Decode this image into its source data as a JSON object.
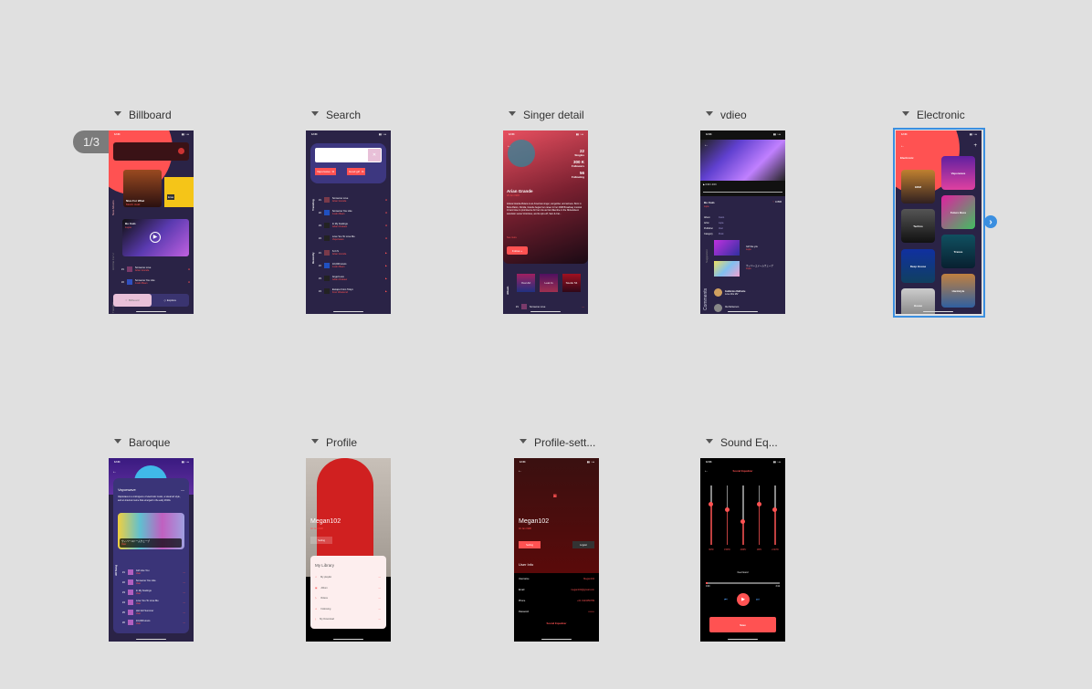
{
  "pager": "1/3",
  "frames": {
    "billboard": {
      "title": "Billboard",
      "side_new": "New Albums",
      "side_hit": "Hit One For U",
      "side_trend": "Trending",
      "album1": "Nice For What",
      "album1_artist": "Moshi Judd",
      "album2": "Eras",
      "video_title": "Bo Cuin",
      "video_sub": "Lupa",
      "songs": [
        {
          "n": "#1",
          "t": "Someone Love",
          "a": "Arian Grande"
        },
        {
          "n": "#2",
          "t": "Someone You Like",
          "a": "Justin Bean"
        }
      ],
      "tab_billboard": "Billboard",
      "tab_explore": "Explore"
    },
    "search": {
      "title": "Search",
      "chip1": "Vaporwave",
      "chip2": "Good girl",
      "trending": "Trending",
      "recently": "Recently",
      "trending_songs": [
        {
          "n": "#1",
          "t": "Someone Love",
          "a": "Arian Grande"
        },
        {
          "n": "#2",
          "t": "Someone You Like",
          "a": "Justin Bean"
        },
        {
          "n": "#3",
          "t": "In My Feelings",
          "a": "Adam Drakew"
        },
        {
          "n": "#4",
          "t": "Love You To Love Me",
          "a": "Vaporwave"
        }
      ],
      "recent_songs": [
        {
          "n": "#1",
          "t": "S.O.S",
          "a": "Arian Grande"
        },
        {
          "n": "#2",
          "t": "10,000 Hours",
          "a": "Justin Bean"
        },
        {
          "n": "#3",
          "t": "Angel Love",
          "a": "Adam Drakew"
        },
        {
          "n": "#4",
          "t": "Escape From Tokyo",
          "a": "Four Weekend"
        }
      ]
    },
    "singer": {
      "title": "Singer detail",
      "name": "Arian Grande",
      "dob": "26 Jun 1993",
      "singles": "22",
      "singles_l": "Singles",
      "followers": "300 K",
      "followers_l": "Followers",
      "following": "56",
      "following_l": "Following",
      "bio": "Ariana Grande-Butera is an American singer, songwriter, and actress. Born in Boca Raton, Florida, Grande began her career in her 2008 Broadway musical 13 and rose to prominence for her role as Cat Valentine in the Nickelodeon television series Victorious, and its spin-off, Sam & Cat...",
      "see_more": "See more",
      "follow": "Follow +",
      "albums_label": "Album",
      "albums": [
        "Your Art",
        "Lost In",
        "Studio 54"
      ],
      "song": "Someone Love",
      "song_n": "#1"
    },
    "video": {
      "title": "vdieo",
      "time": "0:00 / 4:03",
      "song": "Bo Cuin",
      "artist": "Lupa",
      "likes": "10586",
      "info": [
        [
          "Album",
          "Cuion"
        ],
        [
          "Artist",
          "Lupa"
        ],
        [
          "Publisher",
          "Vest"
        ],
        [
          "Category",
          "Punk"
        ]
      ],
      "suggest_label": "Suggestion",
      "suggest": [
        {
          "t": "Girl like you",
          "a": "Lupa"
        },
        {
          "t": "ウィバーユドームウェーブ",
          "a": "Lupa"
        }
      ],
      "comments_label": "Comments",
      "comments": [
        {
          "u": "Guillermo Dalfonte",
          "c": "Love this MV"
        },
        {
          "u": "Iba Nickerson",
          "c": ""
        }
      ]
    },
    "electronic": {
      "title": "Electronic",
      "heading": "Electronic",
      "genres": [
        "EDM",
        "Vaporwave",
        "Techno",
        "Future Bass",
        "Deep House",
        "Trance",
        "House",
        "Hardstyle"
      ]
    },
    "baroque": {
      "title": "Baroque",
      "heading": "Vaporwave",
      "desc": "Vaporwave is a microgenre of electronic music, a visual art style, and an internet meme that emerged in the early 2010s.",
      "feature": "ウィバーユドームウェーブ",
      "feature_sub": "Vaer",
      "list_label": "All Song",
      "songs": [
        {
          "n": "#1",
          "t": "Girl Like You",
          "a": "Vaer"
        },
        {
          "n": "#2",
          "t": "Someone You Like",
          "a": "Vaer"
        },
        {
          "n": "#3",
          "t": "In My Feelings",
          "a": "Vaer"
        },
        {
          "n": "#4",
          "t": "Love You To Love Me",
          "a": "Vaer"
        },
        {
          "n": "#5",
          "t": "Hot Girl Summer",
          "a": "Vaer"
        },
        {
          "n": "#6",
          "t": "10,000 Hours",
          "a": "Vaer"
        }
      ]
    },
    "profile": {
      "title": "Profile",
      "name": "Megan102",
      "dob": "02 Jan 1998",
      "setting": "Setting",
      "library": "My Library",
      "items": [
        "My playlist",
        "Album",
        "Videos",
        "Following",
        "My Download"
      ]
    },
    "profile_settings": {
      "title": "Profile-sett...",
      "name": "Megan102",
      "dob": "02 Jan 1998",
      "setting": "Setting",
      "logout": "Logout",
      "user_info": "User Info",
      "fields": [
        [
          "Username",
          "Megan102"
        ],
        [
          "Email",
          "megan102@gmail.com"
        ],
        [
          "Phone",
          "+01 0123456789"
        ],
        [
          "Password",
          "••••••••"
        ]
      ],
      "eq_link": "Sound Equalizer"
    },
    "sound_eq": {
      "title": "Sound Eq...",
      "heading": "Sound Equalizer",
      "bands": [
        "60Hz",
        "150Hz",
        "400Hz",
        "1KHz",
        "2.4KHz"
      ],
      "levels": [
        0.7,
        0.6,
        0.4,
        0.7,
        0.6
      ],
      "track": "Feel Good",
      "elapsed": "0:00",
      "total": "3:42",
      "progress": 0.02,
      "save": "Save"
    }
  },
  "colors": {
    "accent": "#ff5252",
    "bg": "#2a2346",
    "canvas": "#e0e0e0",
    "selection": "#3b8fe0"
  }
}
